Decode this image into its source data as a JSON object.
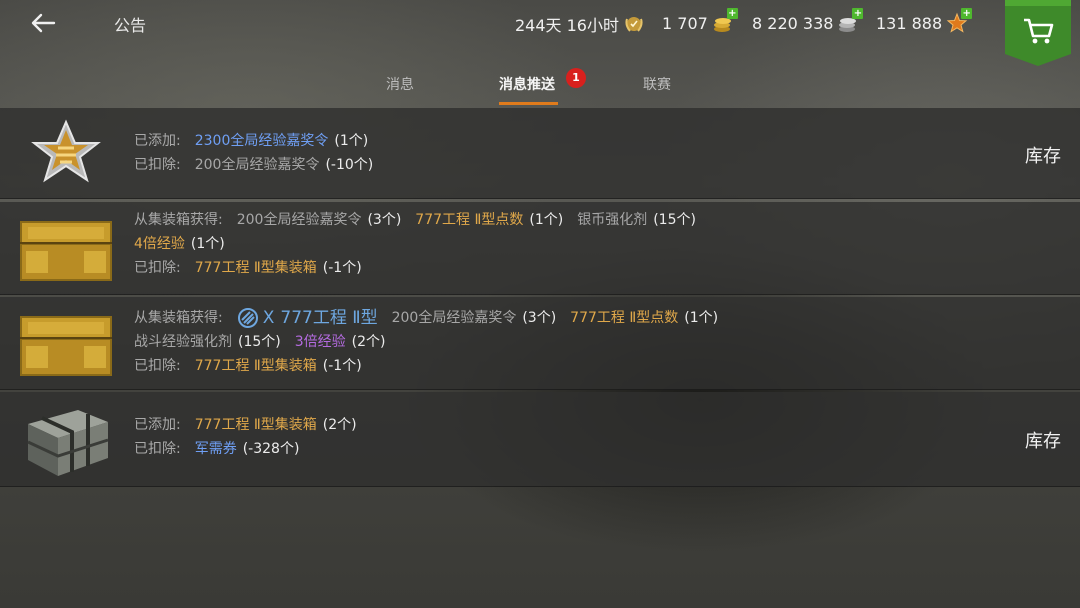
{
  "header": {
    "back_icon": "back-arrow-icon",
    "title": "公告",
    "premium_time": "244天 16小时",
    "premium_icon": "premium-laurel-icon",
    "gold": "1 707",
    "gold_icon": "gold-coins-icon",
    "credits": "8 220 338",
    "credits_icon": "silver-coins-icon",
    "free_xp": "131 888",
    "free_xp_icon": "free-xp-star-icon",
    "plus_label": "+",
    "shop_icon": "shopping-cart-icon",
    "accent_color": "#3e8a2a"
  },
  "tabs": [
    {
      "label": "消息",
      "active": false
    },
    {
      "label": "消息推送",
      "active": true,
      "badge": "1"
    },
    {
      "label": "联赛",
      "active": false
    }
  ],
  "notifications": [
    {
      "icon": "xp-booster-star-icon",
      "lines": [
        [
          {
            "t": "已添加:",
            "c": "lbl"
          },
          {
            "t": "2300全局经验嘉奖令",
            "c": "blue"
          },
          {
            "t": "(1个)",
            "c": "white"
          }
        ],
        [
          {
            "t": "已扣除:",
            "c": "lbl"
          },
          {
            "t": "200全局经验嘉奖令",
            "c": "gray"
          },
          {
            "t": "(-10个)",
            "c": "white"
          }
        ]
      ],
      "action": "库存"
    },
    {
      "icon": "gold-container-icon",
      "lines": [
        [
          {
            "t": "从集装箱获得:",
            "c": "lbl"
          },
          {
            "t": "200全局经验嘉奖令",
            "c": "gray"
          },
          {
            "t": "(3个)",
            "c": "white"
          },
          {
            "t": "777工程 Ⅱ型点数",
            "c": "gold"
          },
          {
            "t": "(1个)",
            "c": "white"
          },
          {
            "t": "银币强化剂",
            "c": "gray"
          },
          {
            "t": "(15个)",
            "c": "white"
          }
        ],
        [
          {
            "t": "4倍经验",
            "c": "gold"
          },
          {
            "t": "(1个)",
            "c": "white"
          }
        ],
        [
          {
            "t": "已扣除:",
            "c": "lbl"
          },
          {
            "t": "777工程 Ⅱ型集装箱",
            "c": "gold"
          },
          {
            "t": "(-1个)",
            "c": "white"
          }
        ]
      ],
      "action": ""
    },
    {
      "icon": "gold-container-icon",
      "tank": "777工程 Ⅱ型",
      "tank_tier": "Ⅹ",
      "lines": [
        [
          {
            "t": "从集装箱获得:",
            "c": "lbl"
          },
          {
            "tank": true
          },
          {
            "t": "200全局经验嘉奖令",
            "c": "gray"
          },
          {
            "t": "(3个)",
            "c": "white"
          },
          {
            "t": "777工程 Ⅱ型点数",
            "c": "gold"
          },
          {
            "t": "(1个)",
            "c": "white"
          }
        ],
        [
          {
            "t": "战斗经验强化剂",
            "c": "gray"
          },
          {
            "t": "(15个)",
            "c": "white"
          },
          {
            "t": "3倍经验",
            "c": "purple"
          },
          {
            "t": "(2个)",
            "c": "white"
          }
        ],
        [
          {
            "t": "已扣除:",
            "c": "lbl"
          },
          {
            "t": "777工程 Ⅱ型集装箱",
            "c": "gold"
          },
          {
            "t": "(-1个)",
            "c": "white"
          }
        ]
      ],
      "action": ""
    },
    {
      "icon": "steel-container-icon",
      "lines": [
        [
          {
            "t": "已添加:",
            "c": "lbl"
          },
          {
            "t": "777工程 Ⅱ型集装箱",
            "c": "gold"
          },
          {
            "t": "(2个)",
            "c": "white"
          }
        ],
        [
          {
            "t": "已扣除:",
            "c": "lbl"
          },
          {
            "t": "军需券",
            "c": "blue"
          },
          {
            "t": "(-328个)",
            "c": "white"
          }
        ]
      ],
      "action": "库存"
    }
  ]
}
